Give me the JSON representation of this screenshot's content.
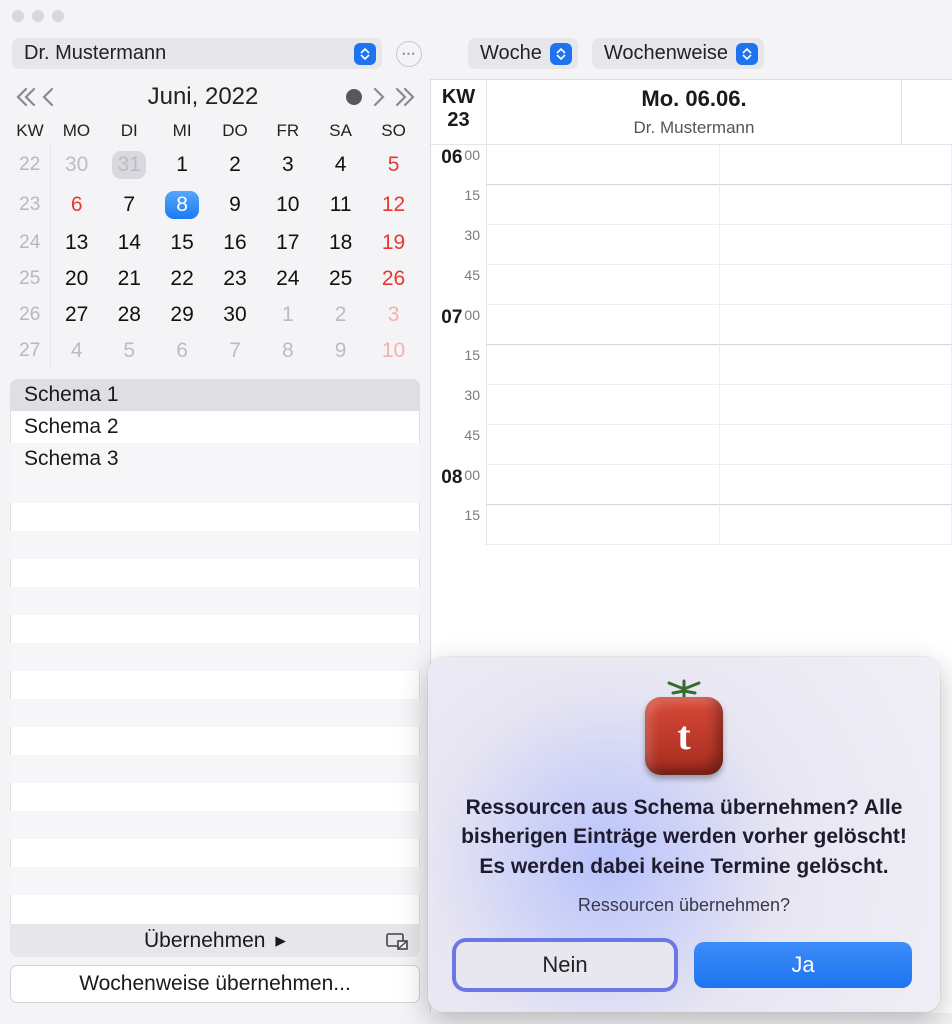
{
  "toolbar": {
    "resource": "Dr. Mustermann",
    "view": "Woche",
    "mode": "Wochenweise"
  },
  "calendar": {
    "title": "Juni, 2022",
    "headers": [
      "KW",
      "MO",
      "DI",
      "MI",
      "DO",
      "FR",
      "SA",
      "SO"
    ],
    "weeks": [
      {
        "kw": "22",
        "days": [
          {
            "d": "30",
            "cls": "other-month"
          },
          {
            "d": "31",
            "cls": "other-month",
            "pill": "grey"
          },
          {
            "d": "1"
          },
          {
            "d": "2"
          },
          {
            "d": "3"
          },
          {
            "d": "4"
          },
          {
            "d": "5",
            "cls": "sunday"
          }
        ]
      },
      {
        "kw": "23",
        "days": [
          {
            "d": "6",
            "cls": "sunday"
          },
          {
            "d": "7"
          },
          {
            "d": "8",
            "pill": "blue"
          },
          {
            "d": "9"
          },
          {
            "d": "10"
          },
          {
            "d": "11"
          },
          {
            "d": "12",
            "cls": "sunday"
          }
        ]
      },
      {
        "kw": "24",
        "days": [
          {
            "d": "13"
          },
          {
            "d": "14"
          },
          {
            "d": "15"
          },
          {
            "d": "16"
          },
          {
            "d": "17"
          },
          {
            "d": "18"
          },
          {
            "d": "19",
            "cls": "sunday"
          }
        ]
      },
      {
        "kw": "25",
        "days": [
          {
            "d": "20"
          },
          {
            "d": "21"
          },
          {
            "d": "22"
          },
          {
            "d": "23"
          },
          {
            "d": "24"
          },
          {
            "d": "25"
          },
          {
            "d": "26",
            "cls": "sunday"
          }
        ]
      },
      {
        "kw": "26",
        "days": [
          {
            "d": "27"
          },
          {
            "d": "28"
          },
          {
            "d": "29"
          },
          {
            "d": "30"
          },
          {
            "d": "1",
            "cls": "other-month"
          },
          {
            "d": "2",
            "cls": "other-month"
          },
          {
            "d": "3",
            "cls": "sunday other-month"
          }
        ]
      },
      {
        "kw": "27",
        "days": [
          {
            "d": "4",
            "cls": "other-month"
          },
          {
            "d": "5",
            "cls": "other-month"
          },
          {
            "d": "6",
            "cls": "other-month"
          },
          {
            "d": "7",
            "cls": "other-month"
          },
          {
            "d": "8",
            "cls": "other-month"
          },
          {
            "d": "9",
            "cls": "other-month"
          },
          {
            "d": "10",
            "cls": "sunday other-month"
          }
        ]
      }
    ]
  },
  "schemas": [
    "Schema 1",
    "Schema 2",
    "Schema 3"
  ],
  "footer": {
    "apply": "Übernehmen",
    "weekly_apply": "Wochenweise übernehmen..."
  },
  "dayview": {
    "kw_label": "KW",
    "kw_num": "23",
    "date": "Mo. 06.06.",
    "resource": "Dr. Mustermann",
    "slots": [
      {
        "h": "06",
        "m": "00",
        "full": true
      },
      {
        "h": "",
        "m": "15"
      },
      {
        "h": "",
        "m": "30"
      },
      {
        "h": "",
        "m": "45"
      },
      {
        "h": "07",
        "m": "00",
        "full": true
      },
      {
        "h": "",
        "m": "15"
      },
      {
        "h": "",
        "m": "30"
      },
      {
        "h": "",
        "m": "45"
      },
      {
        "h": "08",
        "m": "00",
        "full": true
      },
      {
        "h": "",
        "m": "15"
      }
    ]
  },
  "dialog": {
    "heading": "Ressourcen aus Schema übernehmen? Alle bisherigen Einträge werden vorher gelöscht! Es werden dabei keine Termine gelöscht.",
    "sub": "Ressourcen übernehmen?",
    "no": "Nein",
    "yes": "Ja"
  }
}
